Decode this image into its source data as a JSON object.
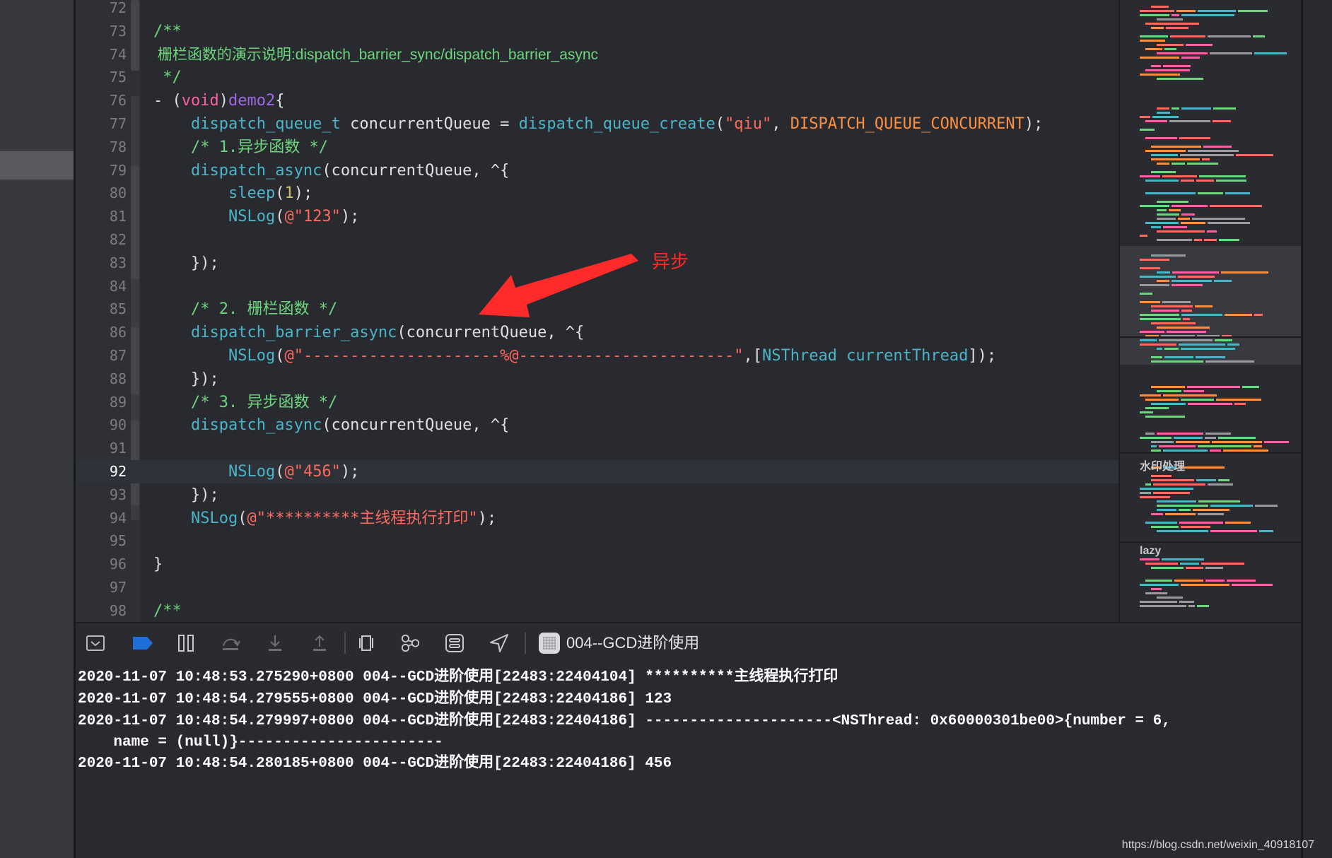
{
  "editor": {
    "current_line": "92",
    "lines": [
      {
        "n": "72",
        "parts": []
      },
      {
        "n": "73",
        "parts": [
          {
            "t": "/**",
            "c": "c"
          }
        ]
      },
      {
        "n": "74",
        "doc": true,
        "parts": [
          {
            "t": " 栅栏函数的演示说明:dispatch_barrier_sync/dispatch_barrier_async",
            "c": "c"
          }
        ]
      },
      {
        "n": "75",
        "parts": [
          {
            "t": " */",
            "c": "c"
          }
        ]
      },
      {
        "n": "76",
        "parts": [
          {
            "t": "- (",
            "c": "pl"
          },
          {
            "t": "void",
            "c": "kw"
          },
          {
            "t": ")",
            "c": "pl"
          },
          {
            "t": "demo2",
            "c": "meth"
          },
          {
            "t": "{",
            "c": "pl"
          }
        ]
      },
      {
        "n": "77",
        "parts": [
          {
            "t": "    ",
            "c": "pl"
          },
          {
            "t": "dispatch_queue_t",
            "c": "fn"
          },
          {
            "t": " concurrentQueue = ",
            "c": "pl"
          },
          {
            "t": "dispatch_queue_create",
            "c": "fn"
          },
          {
            "t": "(",
            "c": "pl"
          },
          {
            "t": "\"qiu\"",
            "c": "str"
          },
          {
            "t": ", ",
            "c": "pl"
          },
          {
            "t": "DISPATCH_QUEUE_CONCURRENT",
            "c": "mac"
          },
          {
            "t": ");",
            "c": "pl"
          }
        ]
      },
      {
        "n": "78",
        "parts": [
          {
            "t": "    /* 1.异步函数 */",
            "c": "c"
          }
        ]
      },
      {
        "n": "79",
        "parts": [
          {
            "t": "    ",
            "c": "pl"
          },
          {
            "t": "dispatch_async",
            "c": "fn"
          },
          {
            "t": "(concurrentQueue, ^{",
            "c": "pl"
          }
        ]
      },
      {
        "n": "80",
        "parts": [
          {
            "t": "        ",
            "c": "pl"
          },
          {
            "t": "sleep",
            "c": "fn"
          },
          {
            "t": "(",
            "c": "pl"
          },
          {
            "t": "1",
            "c": "num"
          },
          {
            "t": ");",
            "c": "pl"
          }
        ]
      },
      {
        "n": "81",
        "parts": [
          {
            "t": "        ",
            "c": "pl"
          },
          {
            "t": "NSLog",
            "c": "fn"
          },
          {
            "t": "(",
            "c": "pl"
          },
          {
            "t": "@\"123\"",
            "c": "str"
          },
          {
            "t": ");",
            "c": "pl"
          }
        ]
      },
      {
        "n": "82",
        "parts": []
      },
      {
        "n": "83",
        "parts": [
          {
            "t": "    });",
            "c": "pl"
          }
        ]
      },
      {
        "n": "84",
        "parts": []
      },
      {
        "n": "85",
        "parts": [
          {
            "t": "    /* 2. 栅栏函数 */",
            "c": "c"
          }
        ]
      },
      {
        "n": "86",
        "parts": [
          {
            "t": "    ",
            "c": "pl"
          },
          {
            "t": "dispatch_barrier_async",
            "c": "fn"
          },
          {
            "t": "(concurrentQueue, ^{",
            "c": "pl"
          }
        ]
      },
      {
        "n": "87",
        "parts": [
          {
            "t": "        ",
            "c": "pl"
          },
          {
            "t": "NSLog",
            "c": "fn"
          },
          {
            "t": "(",
            "c": "pl"
          },
          {
            "t": "@\"---------------------%@-----------------------\"",
            "c": "str"
          },
          {
            "t": ",[",
            "c": "pl"
          },
          {
            "t": "NSThread",
            "c": "fn"
          },
          {
            "t": " ",
            "c": "pl"
          },
          {
            "t": "currentThread",
            "c": "fn"
          },
          {
            "t": "]);",
            "c": "pl"
          }
        ]
      },
      {
        "n": "88",
        "parts": [
          {
            "t": "    });",
            "c": "pl"
          }
        ]
      },
      {
        "n": "89",
        "parts": [
          {
            "t": "    /* 3. 异步函数 */",
            "c": "c"
          }
        ]
      },
      {
        "n": "90",
        "parts": [
          {
            "t": "    ",
            "c": "pl"
          },
          {
            "t": "dispatch_async",
            "c": "fn"
          },
          {
            "t": "(concurrentQueue, ^{",
            "c": "pl"
          }
        ]
      },
      {
        "n": "91",
        "parts": []
      },
      {
        "n": "92",
        "parts": [
          {
            "t": "        ",
            "c": "pl"
          },
          {
            "t": "NSLog",
            "c": "fn"
          },
          {
            "t": "(",
            "c": "pl"
          },
          {
            "t": "@\"456\"",
            "c": "str"
          },
          {
            "t": ");",
            "c": "pl"
          }
        ]
      },
      {
        "n": "93",
        "parts": [
          {
            "t": "    });",
            "c": "pl"
          }
        ]
      },
      {
        "n": "94",
        "parts": [
          {
            "t": "    ",
            "c": "pl"
          },
          {
            "t": "NSLog",
            "c": "fn"
          },
          {
            "t": "(",
            "c": "pl"
          },
          {
            "t": "@\"**********主线程执行打印\"",
            "c": "str"
          },
          {
            "t": ");",
            "c": "pl"
          }
        ]
      },
      {
        "n": "95",
        "parts": []
      },
      {
        "n": "96",
        "parts": [
          {
            "t": "}",
            "c": "pl"
          }
        ]
      },
      {
        "n": "97",
        "parts": []
      },
      {
        "n": "98",
        "parts": [
          {
            "t": "/**",
            "c": "c"
          }
        ]
      }
    ]
  },
  "annotation": {
    "label": "异步",
    "color": "#ff2a2a"
  },
  "minimap": {
    "section_labels": [
      "水印处理",
      "lazy"
    ]
  },
  "debug_bar": {
    "buttons": [
      {
        "name": "hide-debug-area-icon",
        "icon": "tray-down"
      },
      {
        "name": "breakpoints-toggle-icon",
        "icon": "breakpoint-arrow"
      },
      {
        "name": "pause-continue-icon",
        "icon": "pause"
      },
      {
        "name": "step-over-icon",
        "icon": "step-over"
      },
      {
        "name": "step-into-icon",
        "icon": "step-into"
      },
      {
        "name": "step-out-icon",
        "icon": "step-out"
      },
      {
        "name": "debug-view-hierarchy-icon",
        "icon": "view-hierarchy"
      },
      {
        "name": "memory-graph-icon",
        "icon": "memory-graph"
      },
      {
        "name": "environment-overrides-icon",
        "icon": "env-overrides"
      },
      {
        "name": "simulate-location-icon",
        "icon": "location-arrow"
      }
    ],
    "scheme_label": "004--GCD进阶使用"
  },
  "console": {
    "lines": [
      "2020-11-07 10:48:53.275290+0800 004--GCD进阶使用[22483:22404104] **********主线程执行打印",
      "2020-11-07 10:48:54.279555+0800 004--GCD进阶使用[22483:22404186] 123",
      "2020-11-07 10:48:54.279997+0800 004--GCD进阶使用[22483:22404186] ---------------------<NSThread: 0x60000301be00>{number = 6,",
      "    name = (null)}-----------------------",
      "2020-11-07 10:48:54.280185+0800 004--GCD进阶使用[22483:22404186] 456"
    ]
  },
  "watermark": "https://blog.csdn.net/weixin_40918107",
  "colors": {
    "background": "#292a30",
    "comment": "#6cd67c",
    "function": "#4ab4c9",
    "keyword": "#fc5fa3",
    "string": "#fc6a5d",
    "number": "#d0bf69",
    "macro": "#fd8f3f",
    "breakpoint_blue": "#1f6fd6"
  }
}
